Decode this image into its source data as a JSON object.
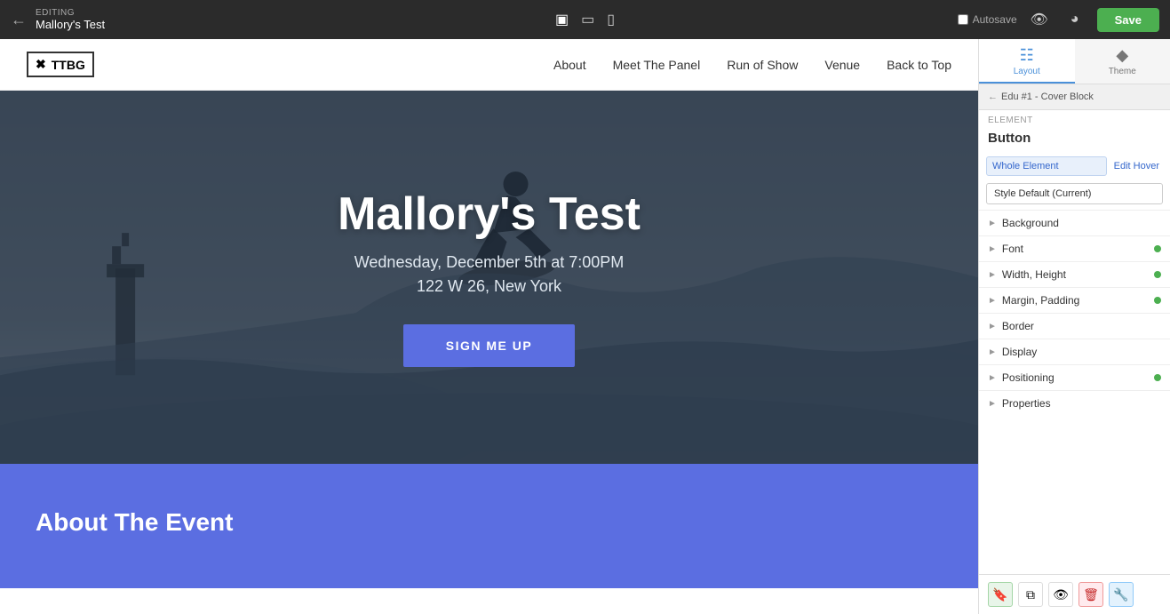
{
  "topbar": {
    "editing_label": "EDITING",
    "page_name": "Mallory's Test",
    "autosave_label": "Autosave",
    "save_label": "Save"
  },
  "device_icons": [
    "desktop",
    "tablet",
    "mobile"
  ],
  "site_nav": {
    "logo_text": "TTBG",
    "links": [
      "About",
      "Meet The Panel",
      "Run of Show",
      "Venue",
      "Back to Top"
    ]
  },
  "hero": {
    "title": "Mallory's Test",
    "date": "Wednesday, December 5th at 7:00PM",
    "address": "122 W 26, New York",
    "cta_label": "SIGN ME UP"
  },
  "about": {
    "title": "About The Event"
  },
  "panel": {
    "tabs": [
      {
        "label": "Layout",
        "active": true
      },
      {
        "label": "Theme",
        "active": false
      }
    ],
    "breadcrumb_back": "←",
    "breadcrumb_text": "Edu #1 - Cover Block",
    "element_label": "Element",
    "section_title": "Button",
    "whole_element_label": "Whole Element",
    "edit_hover_label": "Edit Hover",
    "style_current": "Style Default (Current)",
    "properties": [
      {
        "name": "Background",
        "has_dot": false
      },
      {
        "name": "Font",
        "has_dot": true
      },
      {
        "name": "Width, Height",
        "has_dot": true
      },
      {
        "name": "Margin, Padding",
        "has_dot": true
      },
      {
        "name": "Border",
        "has_dot": false
      },
      {
        "name": "Display",
        "has_dot": false
      },
      {
        "name": "Positioning",
        "has_dot": true
      },
      {
        "name": "Properties",
        "has_dot": false
      }
    ],
    "toolbar_buttons": [
      {
        "icon": "🔖",
        "style": "green"
      },
      {
        "icon": "⧉",
        "style": "normal"
      },
      {
        "icon": "👁",
        "style": "normal"
      },
      {
        "icon": "🗑",
        "style": "red"
      },
      {
        "icon": "🔧",
        "style": "blue"
      }
    ]
  }
}
